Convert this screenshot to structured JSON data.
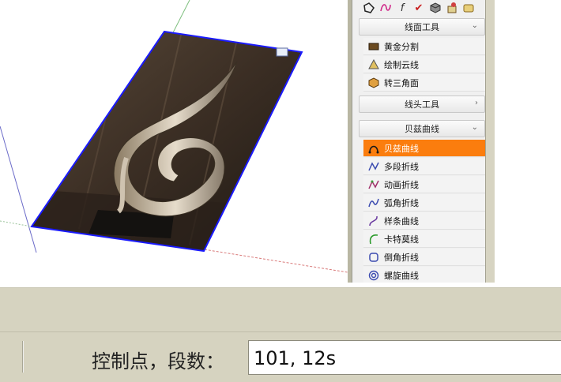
{
  "panel": {
    "toolbar_icons": [
      "polygon-icon",
      "curve-icon",
      "function-icon",
      "check-icon",
      "box-icon",
      "paint-icon",
      "scroll-icon"
    ],
    "sections": [
      {
        "label": "线面工具",
        "state": "expanded",
        "chevron": "⌄"
      },
      {
        "label": "线头工具",
        "state": "collapsed",
        "chevron": "›"
      },
      {
        "label": "贝兹曲线",
        "state": "expanded",
        "chevron": "⌄"
      }
    ],
    "surface_tools": [
      {
        "label": "黄金分割",
        "icon": "golden-ratio-icon"
      },
      {
        "label": "绘制云线",
        "icon": "cloud-line-icon"
      },
      {
        "label": "转三角面",
        "icon": "triangulate-icon"
      }
    ],
    "bezier_tools": [
      {
        "label": "贝兹曲线",
        "icon": "bezier-icon",
        "selected": true
      },
      {
        "label": "多段折线",
        "icon": "polyline-icon"
      },
      {
        "label": "动画折线",
        "icon": "animated-polyline-icon"
      },
      {
        "label": "弧角折线",
        "icon": "arc-polyline-icon"
      },
      {
        "label": "样条曲线",
        "icon": "spline-icon"
      },
      {
        "label": "卡特莫线",
        "icon": "catmull-icon"
      },
      {
        "label": "倒角折线",
        "icon": "chamfer-polyline-icon"
      },
      {
        "label": "螺旋曲线",
        "icon": "spiral-icon"
      }
    ]
  },
  "status_bar": {
    "vcb_label": "控制点，段数：",
    "vcb_value": "101, 12s"
  },
  "colors": {
    "selected_item": "#fb7d0e",
    "selection_outline": "#1a1aff",
    "status_bar_bg": "#d6d3c0"
  }
}
